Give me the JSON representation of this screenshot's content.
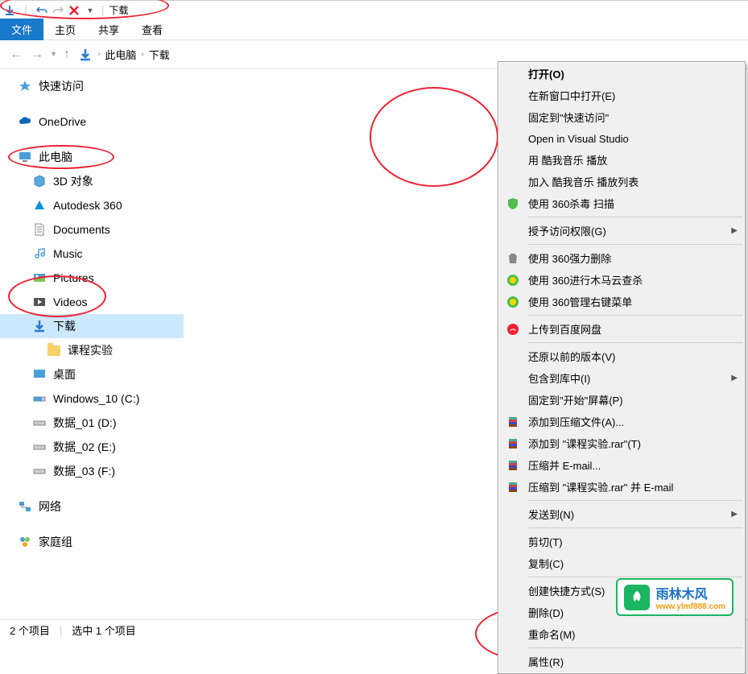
{
  "title_bar": {
    "title": "下载"
  },
  "ribbon": {
    "tabs": [
      "文件",
      "主页",
      "共享",
      "查看"
    ]
  },
  "breadcrumb": {
    "items": [
      "此电脑",
      "下载"
    ]
  },
  "sidebar": {
    "quick_access": "快速访问",
    "onedrive": "OneDrive",
    "this_pc": "此电脑",
    "items": [
      "3D 对象",
      "Autodesk 360",
      "Documents",
      "Music",
      "Pictures",
      "Videos",
      "下载"
    ],
    "download_sub": "课程实验",
    "desktop": "桌面",
    "windows10": "Windows_10 (C:)",
    "drive1": "数据_01 (D:)",
    "drive2": "数据_02 (E:)",
    "drive3": "数据_03 (F:)",
    "network": "网络",
    "homegroup": "家庭组"
  },
  "folder": {
    "name": "课程实验"
  },
  "ctx": {
    "open": "打开(O)",
    "new_window": "在新窗口中打开(E)",
    "pin_quick": "固定到\"快速访问\"",
    "vs": "Open in Visual Studio",
    "kuwo_play": "用 酷我音乐 播放",
    "kuwo_list": "加入 酷我音乐 播放列表",
    "scan360": "使用 360杀毒 扫描",
    "access": "授予访问权限(G)",
    "del360": "使用 360强力删除",
    "trojan360": "使用 360进行木马云查杀",
    "menu360": "使用 360管理右键菜单",
    "baidu": "上传到百度网盘",
    "restore": "还原以前的版本(V)",
    "include_lib": "包含到库中(I)",
    "pin_start": "固定到\"开始\"屏幕(P)",
    "add_archive": "添加到压缩文件(A)...",
    "add_rar": "添加到 \"课程实验.rar\"(T)",
    "compress_email": "压缩并 E-mail...",
    "compress_rar_email": "压缩到 \"课程实验.rar\" 并 E-mail",
    "send_to": "发送到(N)",
    "cut": "剪切(T)",
    "copy": "复制(C)",
    "shortcut": "创建快捷方式(S)",
    "delete": "删除(D)",
    "rename": "重命名(M)",
    "properties": "属性(R)"
  },
  "status": {
    "items": "2 个项目",
    "selected": "选中 1 个项目"
  },
  "watermark": {
    "cn": "雨林木风",
    "url": "www.ylmf888.com"
  }
}
